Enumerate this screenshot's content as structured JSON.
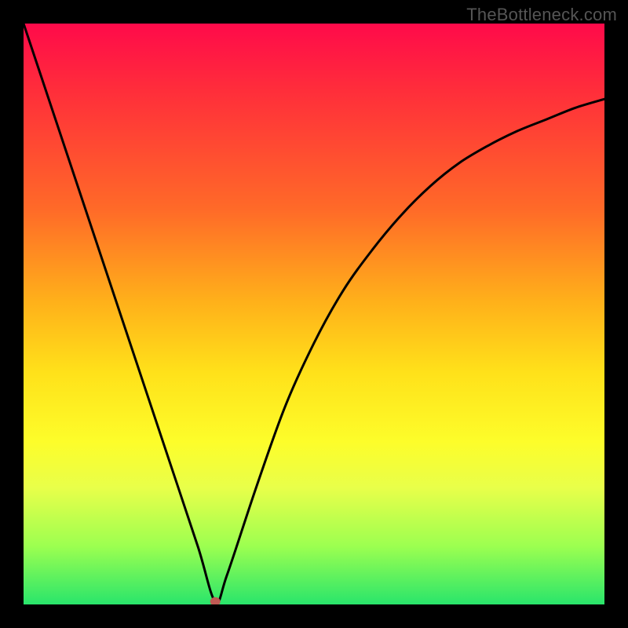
{
  "watermark": "TheBottleneck.com",
  "colors": {
    "frame_bg": "#000000",
    "curve": "#000000",
    "marker": "#c05a54",
    "gradient_top": "#ff0a4a",
    "gradient_bottom": "#29e56b"
  },
  "chart_data": {
    "type": "line",
    "title": "",
    "xlabel": "",
    "ylabel": "",
    "xlim": [
      0,
      100
    ],
    "ylim": [
      0,
      100
    ],
    "series": [
      {
        "name": "bottleneck-curve",
        "x": [
          0,
          5,
          10,
          15,
          20,
          25,
          30,
          33,
          35,
          40,
          45,
          50,
          55,
          60,
          65,
          70,
          75,
          80,
          85,
          90,
          95,
          100
        ],
        "values": [
          100,
          85,
          70,
          55,
          40,
          25,
          10,
          0.5,
          5,
          20,
          34,
          45,
          54,
          61,
          67,
          72,
          76,
          79,
          81.5,
          83.5,
          85.5,
          87
        ]
      }
    ],
    "marker": {
      "x": 33,
      "y": 0.5
    },
    "grid": false,
    "legend": false,
    "note": "Values estimated from pixel positions; y is bottleneck-like metric (0 best, 100 worst)."
  },
  "labels": {
    "watermark_name": "watermark",
    "plot_name": "bottleneck-plot",
    "curve_name": "bottleneck-curve",
    "marker_name": "optimal-point-marker"
  }
}
